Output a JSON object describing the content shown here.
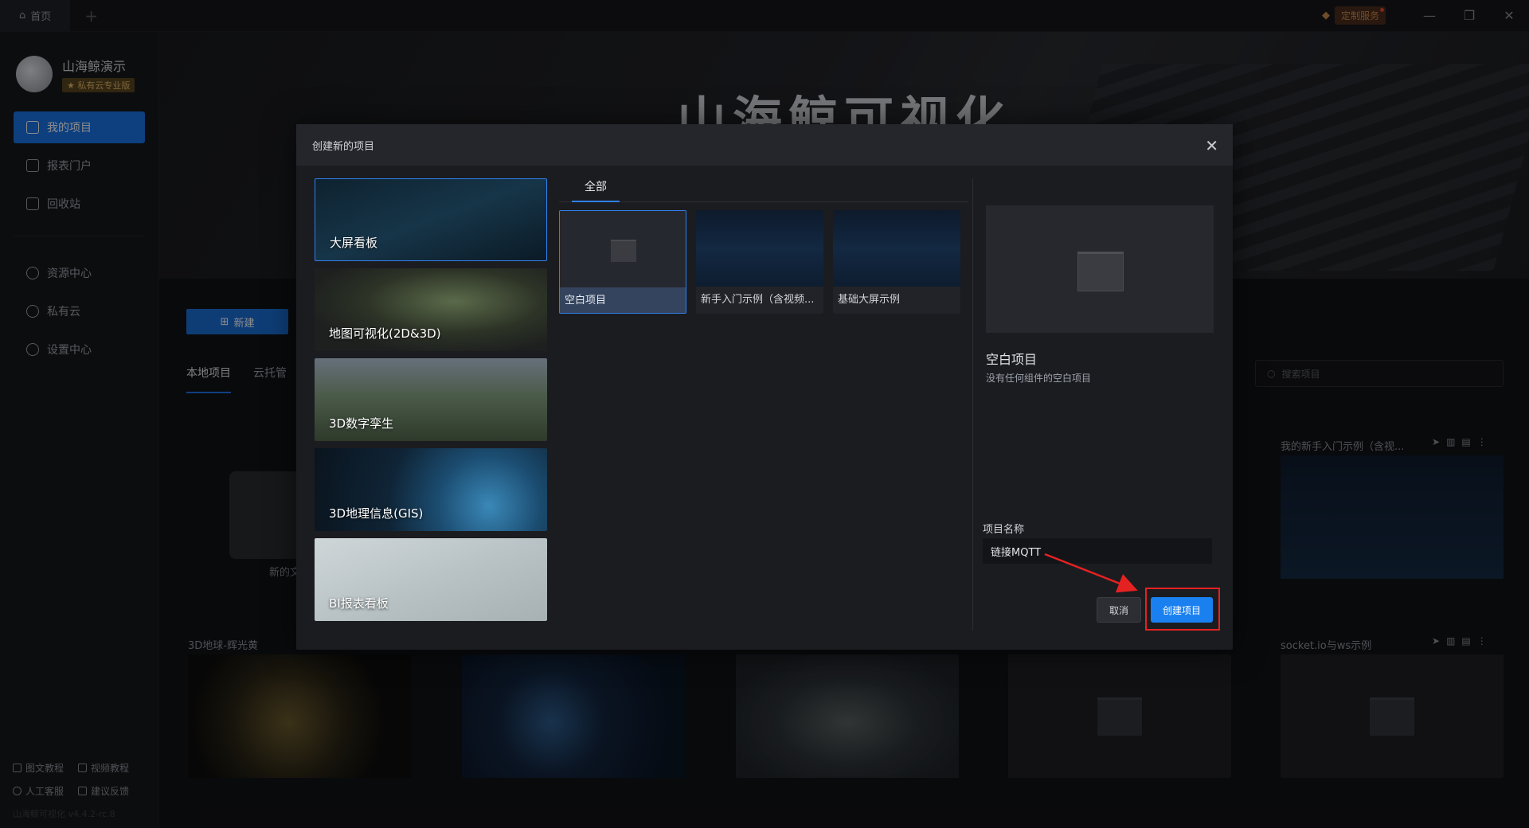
{
  "titlebar": {
    "home_tab": "首页",
    "service_label": "定制服务"
  },
  "user": {
    "name": "山海鲸演示",
    "badge": "私有云专业版"
  },
  "sidebar": {
    "items": [
      {
        "label": "我的项目"
      },
      {
        "label": "报表门户"
      },
      {
        "label": "回收站"
      },
      {
        "label": "资源中心"
      },
      {
        "label": "私有云"
      },
      {
        "label": "设置中心"
      }
    ],
    "footer": {
      "doc_tutorial": "图文教程",
      "video_tutorial": "视频教程",
      "support": "人工客服",
      "feedback": "建议反馈",
      "version": "山海鲸可视化 v4.4.2-rc.8"
    }
  },
  "banner": {
    "title": "山海鲸可视化"
  },
  "main": {
    "new_button": "新建",
    "tabs": [
      "本地项目",
      "云托管"
    ],
    "search_placeholder": "搜索项目",
    "empty_label": "新的文",
    "cards": [
      {
        "label": "我的新手入门示例（含视..."
      },
      {
        "label": "3D地球-辉光黄"
      },
      {
        "label": "socket.io与ws示例"
      }
    ]
  },
  "modal": {
    "title": "创建新的项目",
    "categories": [
      {
        "label": "大屏看板"
      },
      {
        "label": "地图可视化(2D&3D)"
      },
      {
        "label": "3D数字孪生"
      },
      {
        "label": "3D地理信息(GIS)"
      },
      {
        "label": "BI报表看板"
      }
    ],
    "template_tab": "全部",
    "templates": [
      {
        "label": "空白项目"
      },
      {
        "label": "新手入门示例（含视频..."
      },
      {
        "label": "基础大屏示例"
      }
    ],
    "preview": {
      "title": "空白项目",
      "description": "没有任何组件的空白项目"
    },
    "project_name_label": "项目名称",
    "project_name_value": "链接MQTT",
    "cancel_label": "取消",
    "create_label": "创建项目"
  },
  "colors": {
    "accent": "#1a73e8",
    "annotation": "#e52222"
  }
}
